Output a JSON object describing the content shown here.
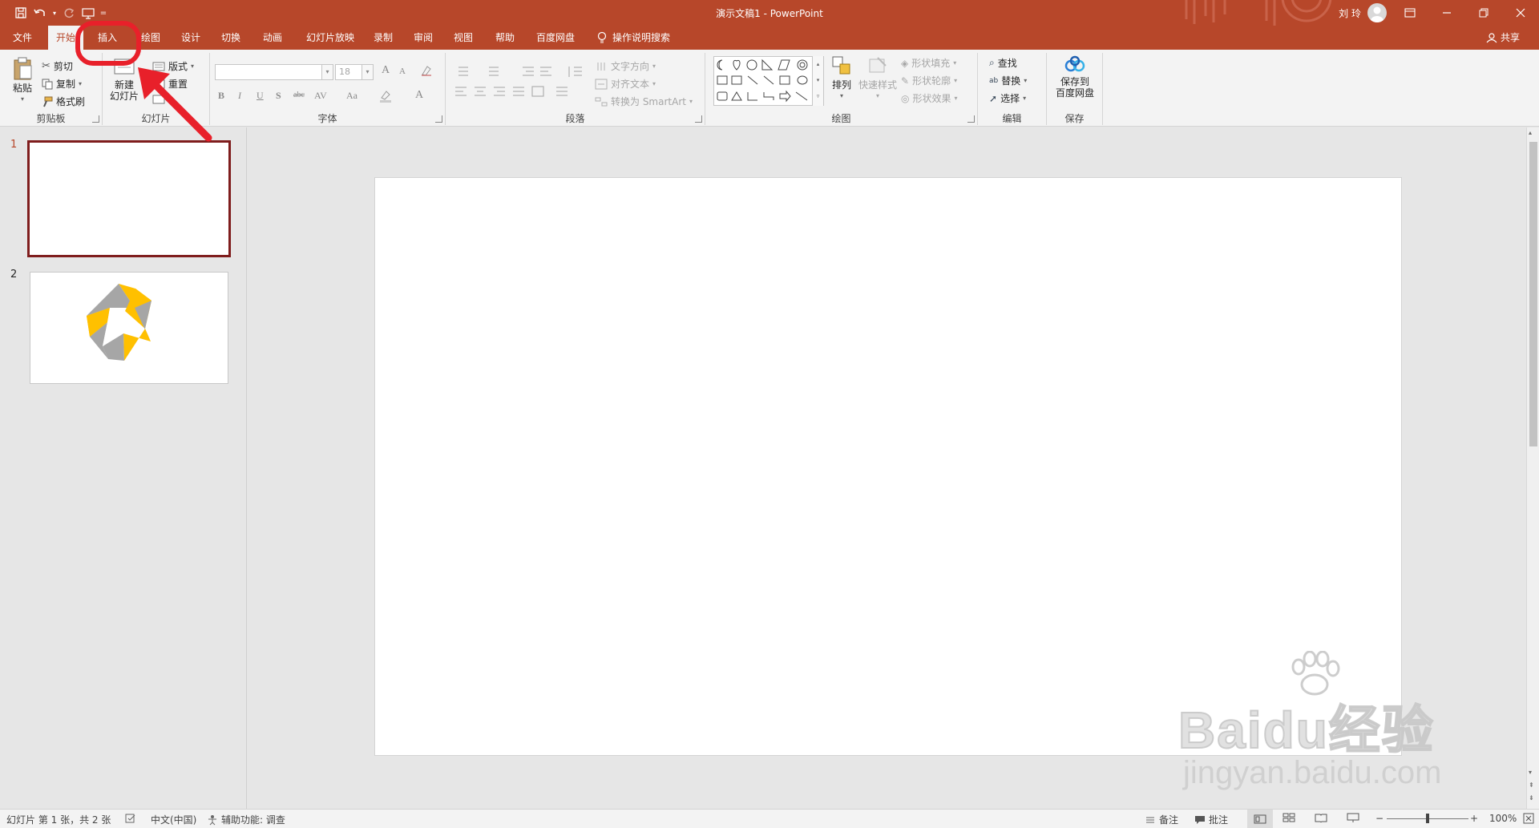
{
  "titlebar": {
    "doc_title": "演示文稿1  -  PowerPoint",
    "user_name": "刘 玲",
    "qat_customize": "⩡"
  },
  "tabs": [
    {
      "label": "文件"
    },
    {
      "label": "开始"
    },
    {
      "label": "插入"
    },
    {
      "label": "绘图"
    },
    {
      "label": "设计"
    },
    {
      "label": "切换"
    },
    {
      "label": "动画"
    },
    {
      "label": "幻灯片放映"
    },
    {
      "label": "录制"
    },
    {
      "label": "审阅"
    },
    {
      "label": "视图"
    },
    {
      "label": "帮助"
    },
    {
      "label": "百度网盘"
    }
  ],
  "tell_me": "操作说明搜索",
  "share": "共享",
  "ribbon": {
    "clipboard": {
      "label": "剪贴板",
      "paste": "粘贴",
      "cut": "剪切",
      "copy": "复制",
      "format_painter": "格式刷"
    },
    "slides": {
      "label": "幻灯片",
      "new_slide_1": "新建",
      "new_slide_2": "幻灯片",
      "layout": "版式",
      "reset": "重置"
    },
    "font": {
      "label": "字体",
      "size": "18",
      "bold": "B",
      "italic": "I",
      "underline": "U",
      "shadow": "S",
      "strike": "abc",
      "spacing": "AV",
      "case": "Aa",
      "grow": "A",
      "shrink": "A"
    },
    "paragraph": {
      "label": "段落",
      "text_direction": "文字方向",
      "align_text": "对齐文本",
      "smartart": "转换为 SmartArt"
    },
    "drawing": {
      "label": "绘图",
      "arrange": "排列",
      "quick_styles": "快速样式",
      "shape_fill": "形状填充",
      "shape_outline": "形状轮廓",
      "shape_effects": "形状效果"
    },
    "editing": {
      "label": "编辑",
      "find": "查找",
      "replace": "替换",
      "select": "选择"
    },
    "save": {
      "label": "保存",
      "save_to_1": "保存到",
      "save_to_2": "百度网盘"
    }
  },
  "thumbnails": [
    {
      "number": "1"
    },
    {
      "number": "2"
    }
  ],
  "statusbar": {
    "slide_info": "幻灯片 第 1 张，共 2 张",
    "language": "中文(中国)",
    "accessibility": "辅助功能: 调查",
    "notes": "备注",
    "comments": "批注",
    "zoom": "100%"
  },
  "watermark": {
    "logo": "Baidu经验",
    "url": "jingyan.baidu.com"
  },
  "colors": {
    "accent": "#b7472a",
    "annotation": "#e8202a",
    "shape_yellow": "#ffc000",
    "shape_gray": "#a6a6a6"
  }
}
